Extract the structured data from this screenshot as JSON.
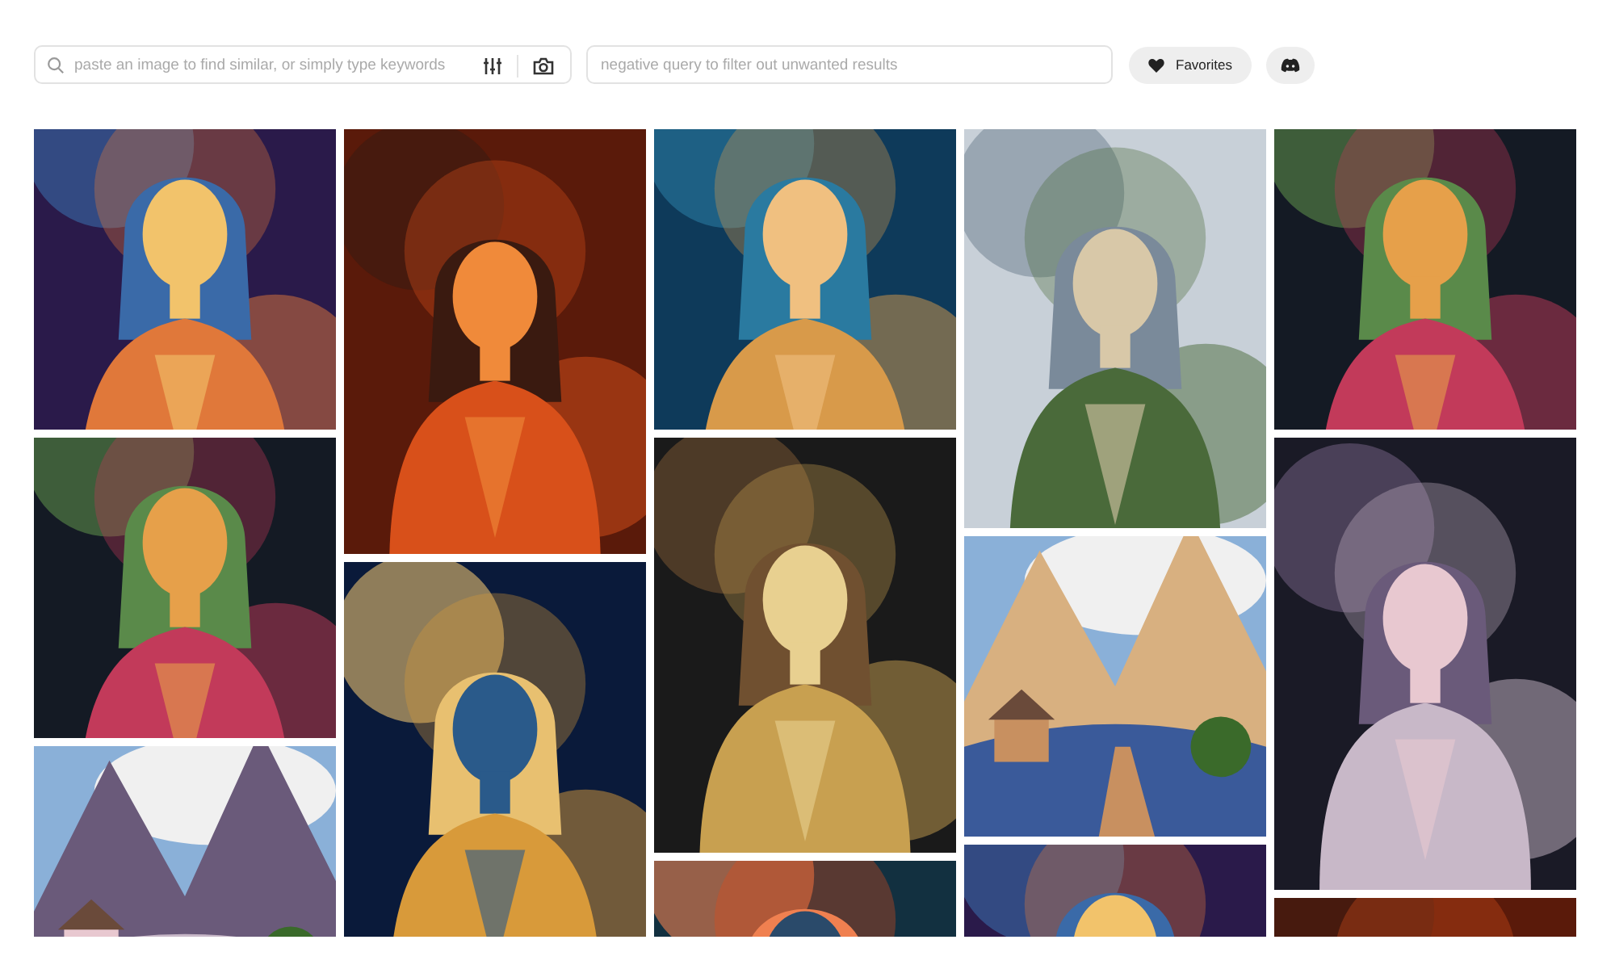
{
  "search": {
    "placeholder": "paste an image to find similar, or simply type keywords"
  },
  "negative_search": {
    "placeholder": "negative query to filter out unwanted results"
  },
  "buttons": [
    {
      "kind": "favorites",
      "label": "Favorites"
    },
    {
      "kind": "discord"
    }
  ]
}
